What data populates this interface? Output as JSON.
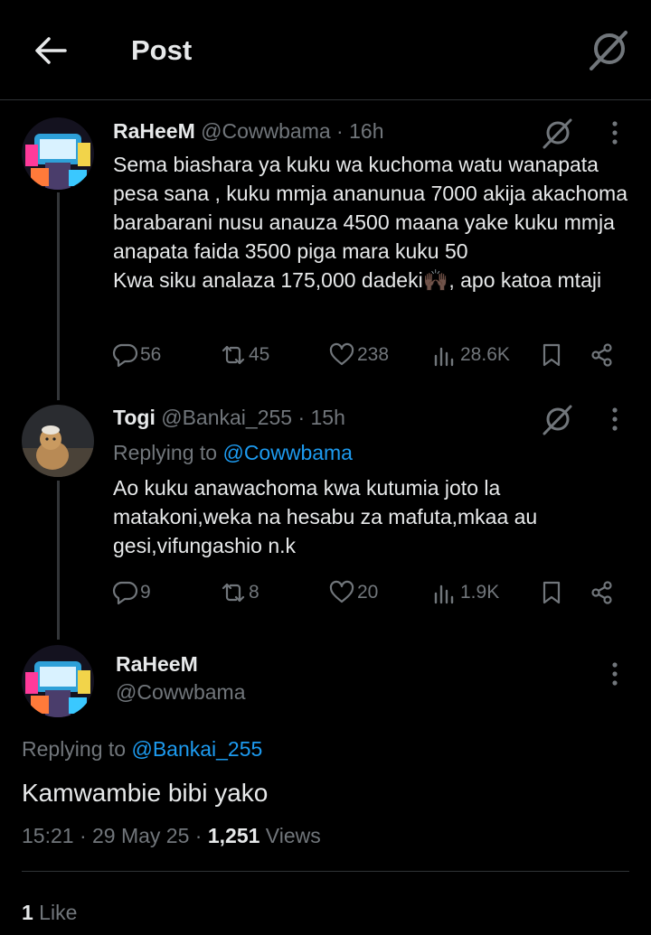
{
  "header": {
    "title": "Post",
    "back_icon": "arrow-left-icon",
    "grok_icon": "grok-icon"
  },
  "tweets": [
    {
      "display_name": "RaHeeM",
      "handle": "@Cowwbama",
      "time": " · 16h",
      "text": "Sema biashara ya kuku wa kuchoma watu wanapata pesa sana , kuku mmja ananunua 7000 akija akachoma barabarani nusu anauza  4500 maana yake kuku mmja anapata faida 3500 piga mara kuku 50\nKwa siku analaza 175,000 dadeki🙌🏿, apo katoa mtaji",
      "replies": "56",
      "reposts": "45",
      "likes": "238",
      "views": "28.6K"
    },
    {
      "display_name": "Togi",
      "handle": "@Bankai_255",
      "time": " · 15h",
      "replying_prefix": "Replying to ",
      "replying_to": "@Cowwbama",
      "text": "Ao kuku anawachoma kwa kutumia joto la matakoni,weka na hesabu za mafuta,mkaa au gesi,vifungashio n.k",
      "replies": "9",
      "reposts": "8",
      "likes": "20",
      "views": "1.9K"
    }
  ],
  "main": {
    "display_name": "RaHeeM",
    "handle": "@Cowwbama",
    "replying_prefix": "Replying to ",
    "replying_to": "@Bankai_255",
    "text": "Kamwambie bibi yako",
    "timestamp": "15:21 · 29 May 25 · ",
    "views_count": "1,251",
    "views_label": " Views",
    "likes_count": "1",
    "likes_label": " Like"
  },
  "colors": {
    "background": "#000000",
    "text": "#e7e9ea",
    "muted": "#71767b",
    "accent": "#1d9bf0",
    "border": "#2f3336"
  }
}
